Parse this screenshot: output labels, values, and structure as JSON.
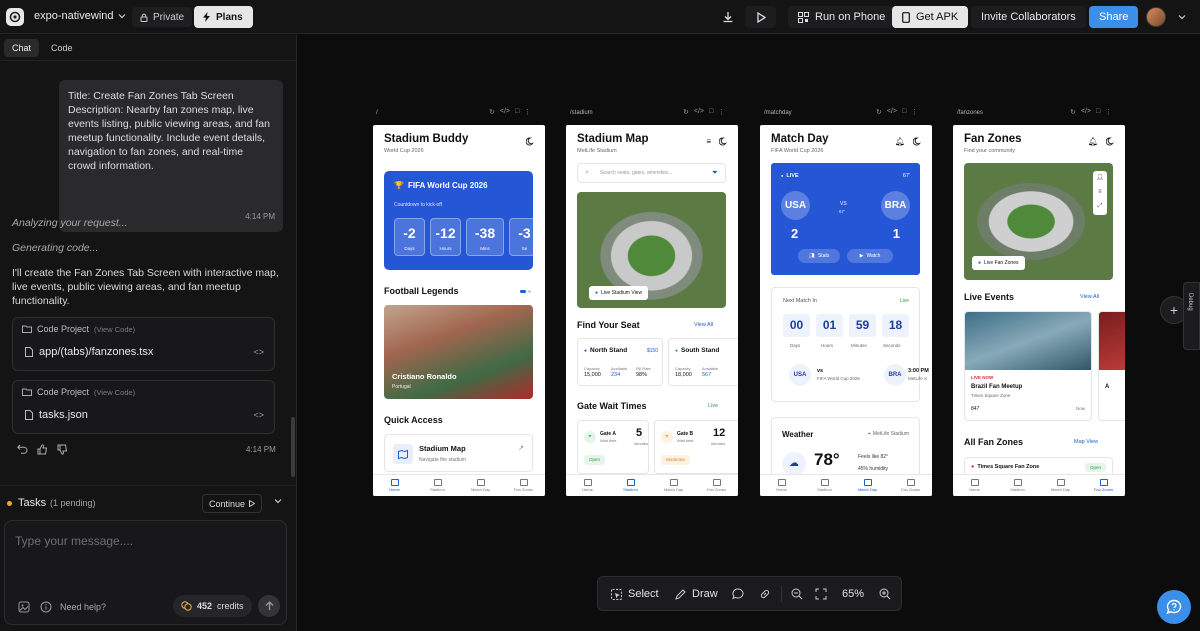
{
  "topbar": {
    "project_name": "expo-nativewind",
    "private_label": "Private",
    "plans_label": "Plans",
    "run_on_phone": "Run on Phone",
    "get_apk": "Get APK",
    "invite": "Invite Collaborators",
    "share": "Share"
  },
  "left": {
    "tabs": [
      {
        "label": "Chat"
      },
      {
        "label": "Code"
      }
    ],
    "user_message": "Title: Create Fan Zones Tab Screen Description: Nearby fan zones map, live events listing, public viewing areas, and fan meetup functionality. Include event details, navigation to fan zones, and real-time crowd information.",
    "user_time": "4:14 PM",
    "status1": "Analyzing your request...",
    "status2": "Generating code...",
    "reply": "I'll create the Fan Zones Tab Screen with interactive map, live events, public viewing areas, and fan meetup functionality.",
    "cards": [
      {
        "header": "Code Project",
        "view": "(View Code)",
        "file": "app/(tabs)/fanzones.tsx"
      },
      {
        "header": "Code Project",
        "view": "(View Code)",
        "file": "tasks.json"
      }
    ],
    "reply_time": "4:14 PM",
    "tasks_label": "Tasks",
    "tasks_pending": "(1 pending)",
    "continue_label": "Continue",
    "composer_placeholder": "Type your message....",
    "need_help": "Need help?",
    "credits_value": "452",
    "credits_label": "credits"
  },
  "frames": [
    {
      "path": "/"
    },
    {
      "path": "/stadium"
    },
    {
      "path": "/matchday"
    },
    {
      "path": "/fanzones"
    }
  ],
  "tabbar": [
    "Home",
    "Stadium",
    "Match Day",
    "Fan Zones"
  ],
  "screen1": {
    "title": "Stadium Buddy",
    "sub": "World Cup 2026",
    "card_title": "FIFA World Cup 2026",
    "countdown_label": "Countdown to kick-off",
    "countdown": [
      {
        "value": "-2",
        "unit": "Days"
      },
      {
        "value": "-12",
        "unit": "Hours"
      },
      {
        "value": "-38",
        "unit": "Mins"
      },
      {
        "value": "-3",
        "unit": "Se"
      }
    ],
    "legends": "Football Legends",
    "player_name": "Cristiano Ronaldo",
    "player_country": "Portugal",
    "quick_access": "Quick Access",
    "qa_title": "Stadium Map",
    "qa_sub": "Navigate the stadium"
  },
  "screen2": {
    "title": "Stadium Map",
    "sub": "MetLife Stadium",
    "search_placeholder": "Search seats, gates, amenities...",
    "live_view": "Live Stadium View",
    "find_seat": "Find Your Seat",
    "view_all": "View All",
    "stands": [
      {
        "name": "North Stand",
        "price": "$150",
        "capacity_label": "Capacity",
        "capacity": "15,000",
        "available_label": "Available",
        "available": "234",
        "fill_label": "Fill Rate",
        "fill": "98%"
      },
      {
        "name": "South Stand",
        "capacity_label": "Capacity",
        "capacity": "18,000",
        "available_label": "Available",
        "available": "567"
      }
    ],
    "gate_wait": "Gate Wait Times",
    "live": "Live",
    "gates": [
      {
        "name": "Gate A",
        "sub": "Wait time",
        "minutes": "5",
        "unit": "minutes",
        "status": "Open"
      },
      {
        "name": "Gate B",
        "sub": "Wait time",
        "minutes": "12",
        "unit": "minutes",
        "status": "Moderate"
      }
    ]
  },
  "screen3": {
    "title": "Match Day",
    "sub": "FIFA World Cup 2026",
    "live": "LIVE",
    "minute": "67'",
    "team1": "USA",
    "team2": "BRA",
    "score1": "2",
    "score2": "1",
    "vs": "VS",
    "vs_min": "67'",
    "stats": "Stats",
    "watch": "Watch",
    "next_match": "Next Match In",
    "next_live": "Live",
    "countdown": [
      {
        "value": "00",
        "unit": "Days"
      },
      {
        "value": "01",
        "unit": "Hours"
      },
      {
        "value": "59",
        "unit": "Minutes"
      },
      {
        "value": "18",
        "unit": "Seconds"
      }
    ],
    "fixture_team1": "USA",
    "fixture_vs": "vs",
    "fixture_event": "FIFA World Cup 2026",
    "fixture_team2": "BRA",
    "fixture_time": "3:00 PM",
    "fixture_venue": "MetLife S",
    "weather": "Weather",
    "weather_venue": "MetLife Stadium",
    "temp": "78°",
    "feels": "Feels like 82°",
    "humidity": "45% humidity"
  },
  "screen4": {
    "title": "Fan Zones",
    "sub": "Find your community",
    "live_fan_zones": "Live Fan Zones",
    "live_events": "Live Events",
    "view_all": "View All",
    "live_now": "LIVE NOW",
    "event_title": "Brazil Fan Meetup",
    "event_place": "Times Square Zone",
    "event_count": "847",
    "event_now": "Now",
    "event2_letter": "A",
    "all_fan_zones": "All Fan Zones",
    "map_view": "Map View",
    "zone_name": "Times Square Fan Zone",
    "zone_status": "Open"
  },
  "toolbar": {
    "select": "Select",
    "draw": "Draw",
    "zoom": "65%"
  },
  "dock": {
    "label": "Debug"
  }
}
